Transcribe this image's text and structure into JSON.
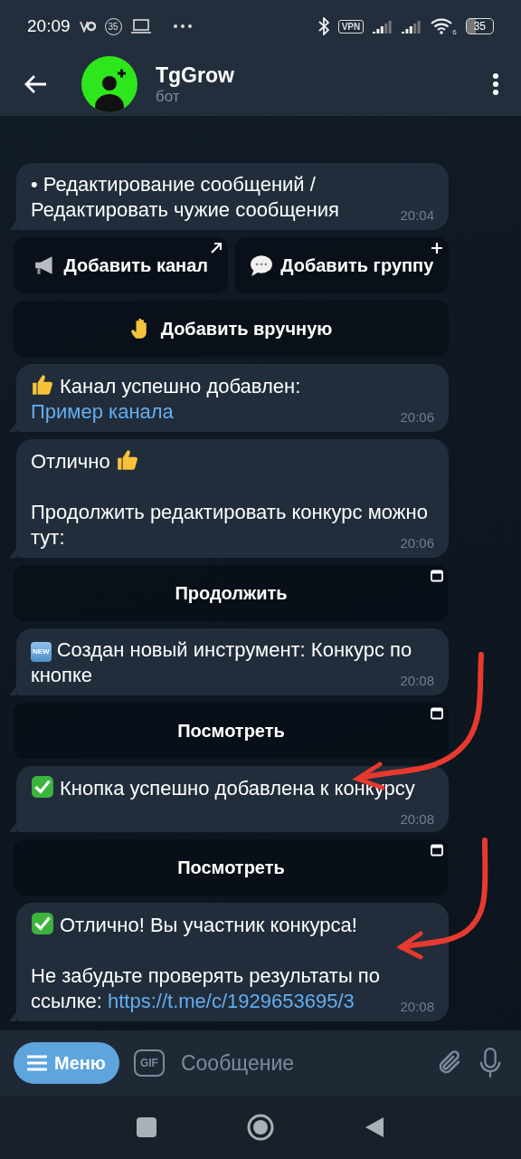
{
  "status_bar": {
    "time": "20:09",
    "badge": "35",
    "vpn": "VPN",
    "wifi_label": "6",
    "battery": "35"
  },
  "header": {
    "title": "TgGrow",
    "subtitle": "бот"
  },
  "chat": [
    {
      "paragraphs": [
        [
          {
            "kind": "text",
            "text": " • Редактирование сообщений / Редактировать чужие сообщения"
          }
        ]
      ],
      "time": "20:04",
      "keyboard": [
        [
          {
            "kind": "url",
            "parts": [
              {
                "kind": "megaphone"
              },
              {
                "kind": "text",
                "text": "Добавить канал"
              }
            ]
          },
          {
            "kind": "add",
            "parts": [
              {
                "kind": "speech"
              },
              {
                "kind": "text",
                "text": "Добавить группу"
              }
            ]
          }
        ],
        [
          {
            "kind": "callback",
            "parts": [
              {
                "kind": "hand"
              },
              {
                "kind": "text",
                "text": "Добавить вручную"
              }
            ]
          }
        ]
      ]
    },
    {
      "paragraphs": [
        [
          {
            "kind": "thumbsup"
          },
          {
            "kind": "text",
            "text": "Канал успешно добавлен: "
          },
          {
            "kind": "link",
            "text": "Пример канала"
          }
        ]
      ],
      "time": "20:06"
    },
    {
      "paragraphs": [
        [
          {
            "kind": "text",
            "text": "Отлично "
          },
          {
            "kind": "thumbsup"
          }
        ],
        [
          {
            "kind": "text",
            "text": "Продолжить редактировать конкурс можно тут:"
          }
        ]
      ],
      "time": "20:06",
      "keyboard": [
        [
          {
            "kind": "webapp",
            "parts": [
              {
                "kind": "text",
                "text": "Продолжить"
              }
            ]
          }
        ]
      ]
    },
    {
      "paragraphs": [
        [
          {
            "kind": "new",
            "text": "NEW"
          },
          {
            "kind": "text",
            "text": "Создан новый инструмент: Конкурс по кнопке"
          }
        ]
      ],
      "time": "20:08",
      "keyboard": [
        [
          {
            "kind": "webapp",
            "parts": [
              {
                "kind": "text",
                "text": "Посмотреть"
              }
            ]
          }
        ]
      ]
    },
    {
      "paragraphs": [
        [
          {
            "kind": "check"
          },
          {
            "kind": "text",
            "text": "Кнопка успешно добавлена к конкурсу"
          }
        ]
      ],
      "time": "20:08",
      "keyboard": [
        [
          {
            "kind": "webapp",
            "parts": [
              {
                "kind": "text",
                "text": "Посмотреть"
              }
            ]
          }
        ]
      ]
    },
    {
      "paragraphs": [
        [
          {
            "kind": "check"
          },
          {
            "kind": "text",
            "text": "Отлично! Вы участник конкурса!"
          }
        ],
        [
          {
            "kind": "text",
            "text": "Не забудьте проверять результаты по ссылке: "
          },
          {
            "kind": "link",
            "text": "https://t.me/c/1929653695/3"
          }
        ]
      ],
      "time": "20:08"
    }
  ],
  "composer": {
    "menu": "Меню",
    "gif": "GIF",
    "placeholder": "Сообщение"
  }
}
